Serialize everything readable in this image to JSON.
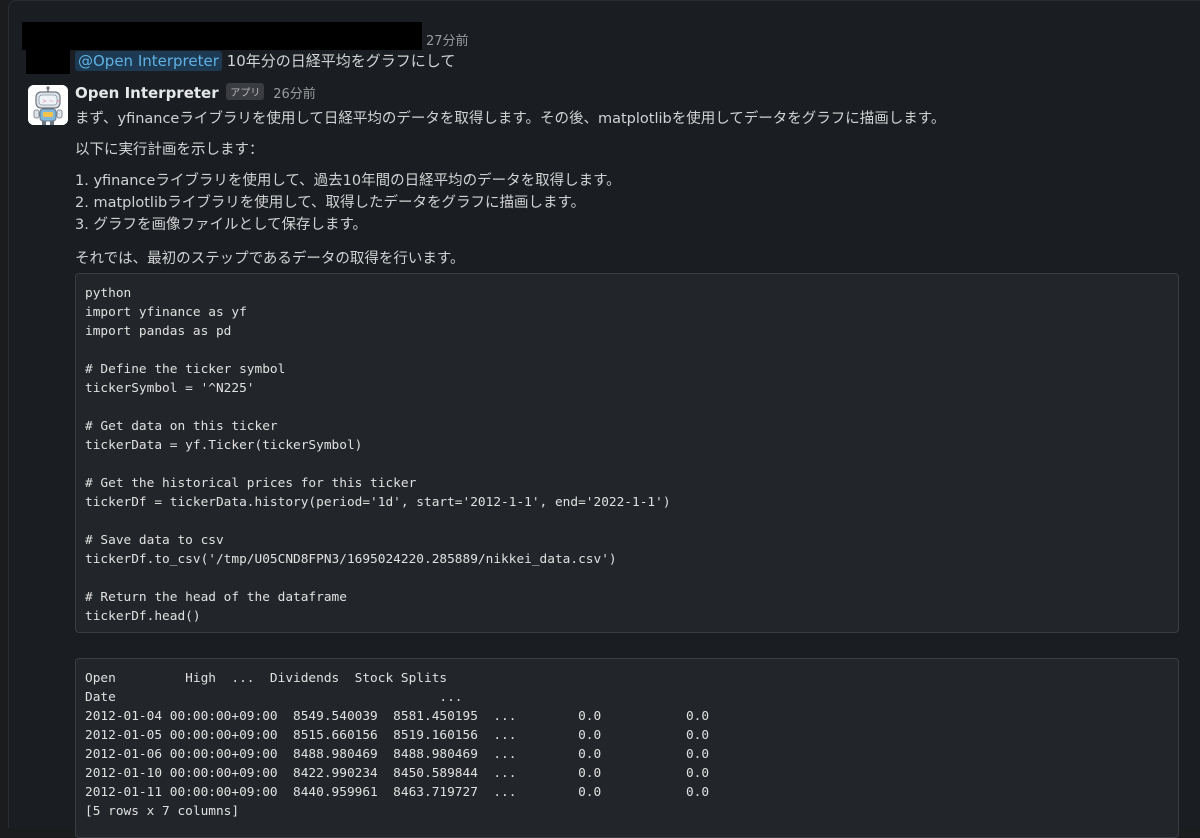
{
  "message1": {
    "time": "27分前",
    "mention": "@Open Interpreter",
    "text": "10年分の日経平均をグラフにして"
  },
  "message2": {
    "sender": "Open Interpreter",
    "badge": "アプリ",
    "time": "26分前",
    "intro": "まず、yfinanceライブラリを使用して日経平均のデータを取得します。その後、matplotlibを使用してデータをグラフに描画します。",
    "plan_heading": "以下に実行計画を示します：",
    "steps": [
      "1. yfinanceライブラリを使用して、過去10年間の日経平均のデータを取得します。",
      "2. matplotlibライブラリを使用して、取得したデータをグラフに描画します。",
      "3. グラフを画像ファイルとして保存します。"
    ],
    "transition": "それでは、最初のステップであるデータの取得を行います。",
    "code": "python\nimport yfinance as yf\nimport pandas as pd\n\n# Define the ticker symbol\ntickerSymbol = '^N225'\n\n# Get data on this ticker\ntickerData = yf.Ticker(tickerSymbol)\n\n# Get the historical prices for this ticker\ntickerDf = tickerData.history(period='1d', start='2012-1-1', end='2022-1-1')\n\n# Save data to csv\ntickerDf.to_csv('/tmp/U05CND8FPN3/1695024220.285889/nikkei_data.csv')\n\n# Return the head of the dataframe\ntickerDf.head()",
    "output": "Open         High  ...  Dividends  Stock Splits\nDate                                          ...                       \n2012-01-04 00:00:00+09:00  8549.540039  8581.450195  ...        0.0           0.0\n2012-01-05 00:00:00+09:00  8515.660156  8519.160156  ...        0.0           0.0\n2012-01-06 00:00:00+09:00  8488.980469  8488.980469  ...        0.0           0.0\n2012-01-10 00:00:00+09:00  8422.990234  8450.589844  ...        0.0           0.0\n2012-01-11 00:00:00+09:00  8440.959961  8463.719727  ...        0.0           0.0\n[5 rows x 7 columns]"
  },
  "colors": {
    "background": "#1a1d21",
    "code_bg": "#222529",
    "mention_bg": "#1d3a52",
    "mention_text": "#5fb1e3"
  }
}
